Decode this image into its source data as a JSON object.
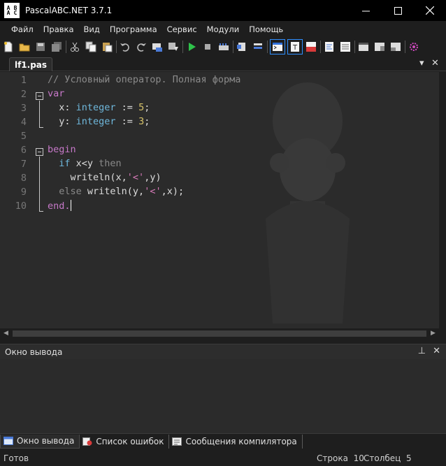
{
  "window": {
    "title": "PascalABC.NET 3.7.1",
    "icon_text": [
      "A",
      "B",
      "A",
      "C"
    ],
    "controls": [
      "minimize-icon",
      "maximize-icon",
      "close-icon"
    ]
  },
  "menu": [
    "Файл",
    "Правка",
    "Вид",
    "Программа",
    "Сервис",
    "Модули",
    "Помощь"
  ],
  "toolbar": {
    "icons": [
      "new-file-icon",
      "open-folder-icon",
      "save-icon",
      "save-all-icon",
      "cut-icon",
      "copy-icon",
      "paste-icon",
      "undo-icon",
      "redo-icon",
      "find-icon",
      "replace-icon",
      "run-icon",
      "stop-icon",
      "compile-icon",
      "step-into-icon",
      "step-over-icon",
      "console-icon",
      "text-icon",
      "abc-icon",
      "format-icon",
      "code-templates-icon",
      "debug-window-icon",
      "watch-icon",
      "locals-icon",
      "settings-icon"
    ]
  },
  "editor": {
    "tab_label": "lf1.pas",
    "tab_menu_icon": "chevron-down-icon",
    "tab_close_icon": "close-icon",
    "line_numbers": [
      "1",
      "2",
      "3",
      "4",
      "5",
      "6",
      "7",
      "8",
      "9",
      "10"
    ],
    "lines": [
      [
        {
          "t": "// Условный оператор. Полная форма",
          "c": "comment"
        }
      ],
      [
        {
          "t": "var",
          "c": "kw"
        }
      ],
      [
        {
          "t": "  x: ",
          "c": "op"
        },
        {
          "t": "integer",
          "c": "type"
        },
        {
          "t": " := ",
          "c": "op"
        },
        {
          "t": "5",
          "c": "num"
        },
        {
          "t": ";",
          "c": "op"
        }
      ],
      [
        {
          "t": "  y: ",
          "c": "op"
        },
        {
          "t": "integer",
          "c": "type"
        },
        {
          "t": " := ",
          "c": "op"
        },
        {
          "t": "3",
          "c": "num"
        },
        {
          "t": ";",
          "c": "op"
        }
      ],
      [],
      [
        {
          "t": "begin",
          "c": "kw"
        }
      ],
      [
        {
          "t": "  ",
          "c": "op"
        },
        {
          "t": "if",
          "c": "type"
        },
        {
          "t": " x<y ",
          "c": "op"
        },
        {
          "t": "then",
          "c": "comment"
        }
      ],
      [
        {
          "t": "    writeln(x,",
          "c": "op"
        },
        {
          "t": "'<'",
          "c": "str"
        },
        {
          "t": ",y)",
          "c": "op"
        }
      ],
      [
        {
          "t": "  ",
          "c": "op"
        },
        {
          "t": "else",
          "c": "comment"
        },
        {
          "t": " writeln(y,",
          "c": "op"
        },
        {
          "t": "'<'",
          "c": "str"
        },
        {
          "t": ",x);",
          "c": "op"
        }
      ],
      [
        {
          "t": "end.",
          "c": "kw"
        }
      ]
    ]
  },
  "output_panel": {
    "title": "Окно вывода",
    "pin_icon": "pin-icon",
    "close_icon": "close-icon"
  },
  "bottom_tabs": [
    {
      "label": "Окно вывода",
      "icon": "output-window-icon",
      "active": true
    },
    {
      "label": "Список ошибок",
      "icon": "error-list-icon",
      "active": false
    },
    {
      "label": "Сообщения компилятора",
      "icon": "compiler-messages-icon",
      "active": false
    }
  ],
  "status": {
    "ready": "Готов",
    "row_label": "Строка",
    "row_value": "10",
    "col_label": "Столбец",
    "col_value": "5"
  },
  "colors": {
    "background": "#2b2b2b",
    "comment": "#8a8a8a",
    "keyword": "#c678c8",
    "type": "#6fb8dc",
    "number": "#d7c36a",
    "string": "#d77ab8",
    "toolbar_highlight": "#2f8fff"
  }
}
